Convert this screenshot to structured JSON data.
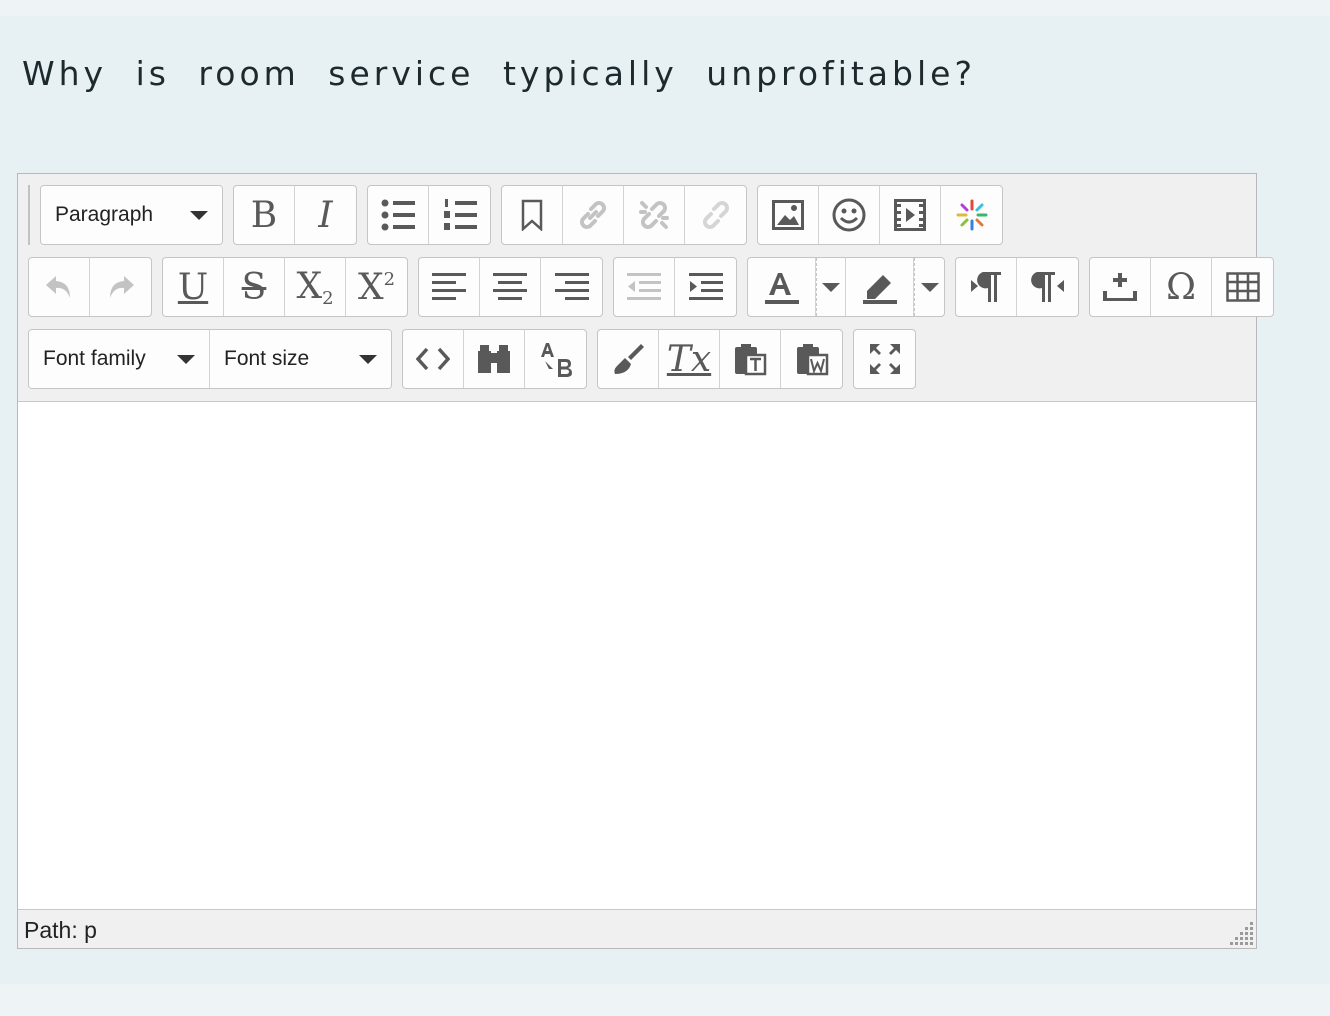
{
  "question": {
    "text": "Why is room service typically unprofitable?"
  },
  "editor": {
    "format_select": "Paragraph",
    "font_family_select": "Font family",
    "font_size_select": "Font size",
    "buttons": {
      "bold": "B",
      "italic": "I",
      "underline": "U",
      "strikethrough": "S",
      "subscript_base": "X",
      "subscript_index": "2",
      "superscript_base": "X",
      "superscript_index": "2",
      "clear_formatting": "Tx",
      "special_char": "Ω"
    },
    "status": {
      "path": "Path: p"
    },
    "content": ""
  },
  "colors": {
    "page_bg": "#e7f0f3",
    "toolbar_bg": "#f0f0f0",
    "icon": "#595959",
    "icon_disabled": "#c3c3c3"
  }
}
